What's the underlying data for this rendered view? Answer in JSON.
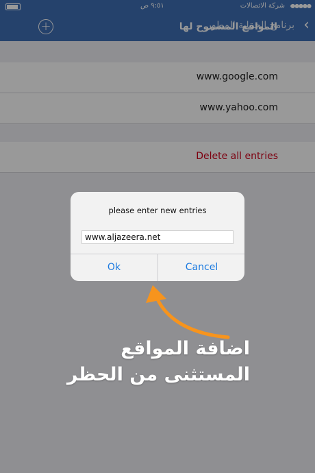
{
  "status_bar": {
    "carrier": "شركة الاتصالات",
    "time": "٩:٥١ ص"
  },
  "nav": {
    "back_label": "برنامج الحماية المطور",
    "title": "المواقع المسموح لها",
    "add_icon": "plus-circle-icon",
    "background_color": "#3f6fb5"
  },
  "list": {
    "sites": [
      "www.google.com",
      "www.yahoo.com"
    ],
    "delete_label": "Delete all entries",
    "delete_color": "#d0021b"
  },
  "alert": {
    "message": "please enter new entries",
    "input_value": "www.aljazeera.net",
    "ok_label": "Ok",
    "cancel_label": "Cancel",
    "button_color": "#1b7ae0"
  },
  "annotation": {
    "line1": "اضافة المواقع",
    "line2": "المستثنى من الحظر",
    "arrow_color": "#f7941d"
  }
}
